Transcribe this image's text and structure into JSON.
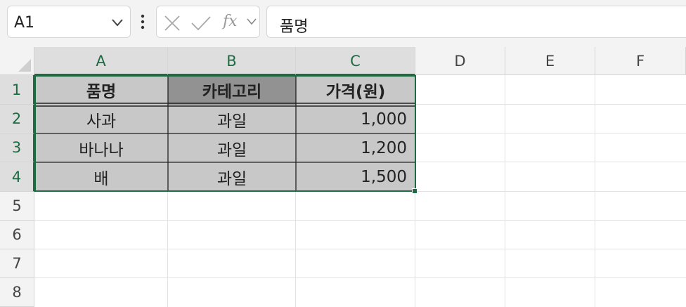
{
  "name_box": {
    "value": "A1"
  },
  "formula_bar": {
    "content": "품명",
    "fx_label": "fx"
  },
  "columns": [
    "A",
    "B",
    "C",
    "D",
    "E",
    "F"
  ],
  "rows": [
    "1",
    "2",
    "3",
    "4",
    "5",
    "6",
    "7",
    "8"
  ],
  "table": {
    "headers": [
      "품명",
      "카테고리",
      "가격(원)"
    ],
    "body": [
      [
        "사과",
        "과일",
        "1,000"
      ],
      [
        "바나나",
        "과일",
        "1,200"
      ],
      [
        "배",
        "과일",
        "1,500"
      ]
    ]
  },
  "colors": {
    "accent": "#1e6b43",
    "cell_fill": "#c8c8c8",
    "header_fill_b": "#929292"
  }
}
